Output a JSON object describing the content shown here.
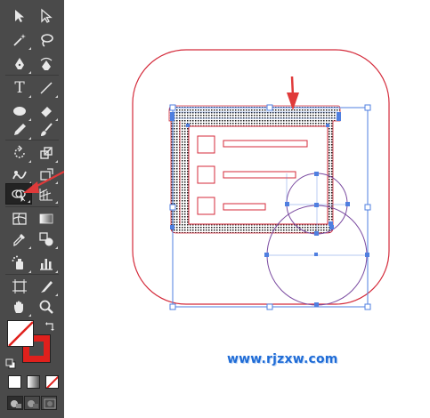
{
  "toolbar": {
    "tools": [
      {
        "name": "selection-tool-icon"
      },
      {
        "name": "direct-selection-tool-icon"
      },
      {
        "name": "magic-wand-tool-icon"
      },
      {
        "name": "lasso-tool-icon"
      },
      {
        "name": "pen-tool-icon"
      },
      {
        "name": "curvature-tool-icon"
      },
      {
        "name": "type-tool-icon",
        "glyph": "T"
      },
      {
        "name": "line-segment-tool-icon"
      },
      {
        "name": "ellipse-tool-icon"
      },
      {
        "name": "eraser-tool-icon"
      },
      {
        "name": "pencil-tool-icon"
      },
      {
        "name": "paintbrush-tool-icon"
      },
      {
        "name": "rotate-tool-icon"
      },
      {
        "name": "scale-tool-icon"
      },
      {
        "name": "warp-tool-icon"
      },
      {
        "name": "free-transform-tool-icon"
      },
      {
        "name": "shape-builder-tool-icon",
        "active": true
      },
      {
        "name": "graph-tool-icon"
      },
      {
        "name": "mesh-tool-icon"
      },
      {
        "name": "gradient-tool-icon"
      },
      {
        "name": "eyedropper-tool-icon"
      },
      {
        "name": "blend-tool-icon"
      },
      {
        "name": "symbol-sprayer-tool-icon"
      },
      {
        "name": "column-graph-tool-icon"
      },
      {
        "name": "artboard-tool-icon"
      },
      {
        "name": "slice-tool-icon"
      },
      {
        "name": "hand-tool-icon"
      },
      {
        "name": "zoom-tool-icon"
      }
    ],
    "fill_color": "#ffffff",
    "stroke_color": "#e0201c"
  },
  "canvas": {
    "accent_stroke": "#d42a3a",
    "selection_color": "#4f7fe0",
    "circle_color": "#7a4aa0",
    "arrow_color": "#e03a3a"
  },
  "watermark": {
    "text": "www.rjzxw.com"
  }
}
